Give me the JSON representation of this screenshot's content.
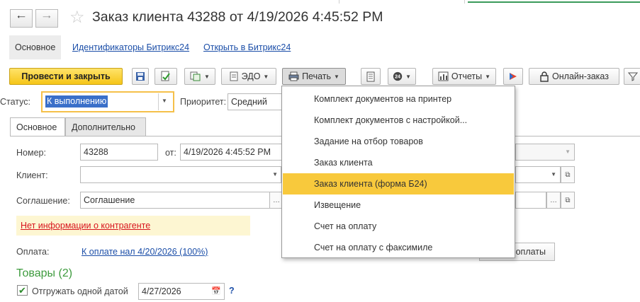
{
  "window": {
    "title": "Заказ клиента 43288 от 4/19/2026 4:45:52 PM"
  },
  "nav": {
    "back_icon": "arrow-left-icon",
    "forward_icon": "arrow-right-icon",
    "favorite_icon": "star-icon"
  },
  "sections": {
    "main_label": "Основное",
    "links": [
      "Идентификаторы Битрикс24",
      "Открыть в Битрикс24"
    ]
  },
  "toolbar": {
    "post_close_label": "Провести и закрыть",
    "edo_label": "ЭДО",
    "print_label": "Печать",
    "reports_label": "Отчеты",
    "online_order_label": "Онлайн-заказ",
    "icons": [
      "save-icon",
      "post-icon",
      "create-based-icon",
      "edo-icon",
      "print-icon",
      "document-icon",
      "24-icon",
      "reports-icon",
      "flag-icon",
      "lock-icon",
      "filter-icon"
    ]
  },
  "status": {
    "label": "Статус:",
    "value": "К выполнению",
    "priority_label": "Приоритет:",
    "priority_value": "Средний"
  },
  "form_tabs": [
    "Основное",
    "Дополнительно"
  ],
  "form": {
    "number_label": "Номер:",
    "number_value": "43288",
    "from_label": "от:",
    "date_value": "4/19/2026  4:45:52 PM",
    "client_label": "Клиент:",
    "client_value": "",
    "agreement_label": "Соглашение:",
    "agreement_value": "Соглашение",
    "warning_link": "Нет информации о контрагенте",
    "payment_label": "Оплата:",
    "payment_link": "К оплате нал 4/20/2026 (100%)",
    "payments_button_label": "оплаты"
  },
  "goods": {
    "title": "Товары (2)",
    "ship_one_date_label": "Отгружать одной датой",
    "ship_one_date_checked": true,
    "ship_date": "4/27/2026",
    "help_label": "?"
  },
  "print_menu": {
    "items": [
      "Комплект документов на принтер",
      "Комплект документов с настройкой...",
      "Задание на отбор товаров",
      "Заказ клиента",
      "Заказ клиента (форма Б24)",
      "Извещение",
      "Счет на оплату",
      "Счет на оплату с факсимиле"
    ],
    "highlighted_index": 4
  },
  "colors": {
    "accent_yellow": "#f5c518",
    "highlight": "#f8c93c",
    "link": "#1b4ea8",
    "warning": "#d8141d",
    "section_green": "#3e9b3e",
    "selection_blue": "#3a6fc9"
  }
}
